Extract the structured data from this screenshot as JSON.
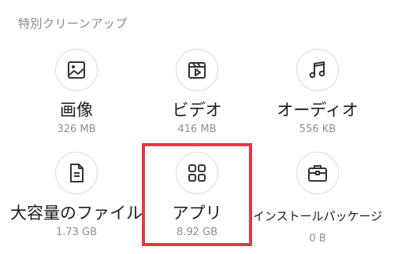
{
  "section": {
    "title": "特別クリーンアップ"
  },
  "items": [
    {
      "label": "画像",
      "size": "326 MB",
      "icon": "image-icon"
    },
    {
      "label": "ビデオ",
      "size": "416 MB",
      "icon": "video-icon"
    },
    {
      "label": "オーディオ",
      "size": "556 KB",
      "icon": "music-note-icon"
    },
    {
      "label": "大容量のファイル",
      "size": "1.73 GB",
      "icon": "document-icon"
    },
    {
      "label": "アプリ",
      "size": "8.92 GB",
      "icon": "apps-grid-icon"
    },
    {
      "label": "インストールパッケージ",
      "size": "0 B",
      "icon": "briefcase-icon"
    }
  ],
  "highlight": {
    "color": "#e03a44",
    "target": "アプリ"
  }
}
